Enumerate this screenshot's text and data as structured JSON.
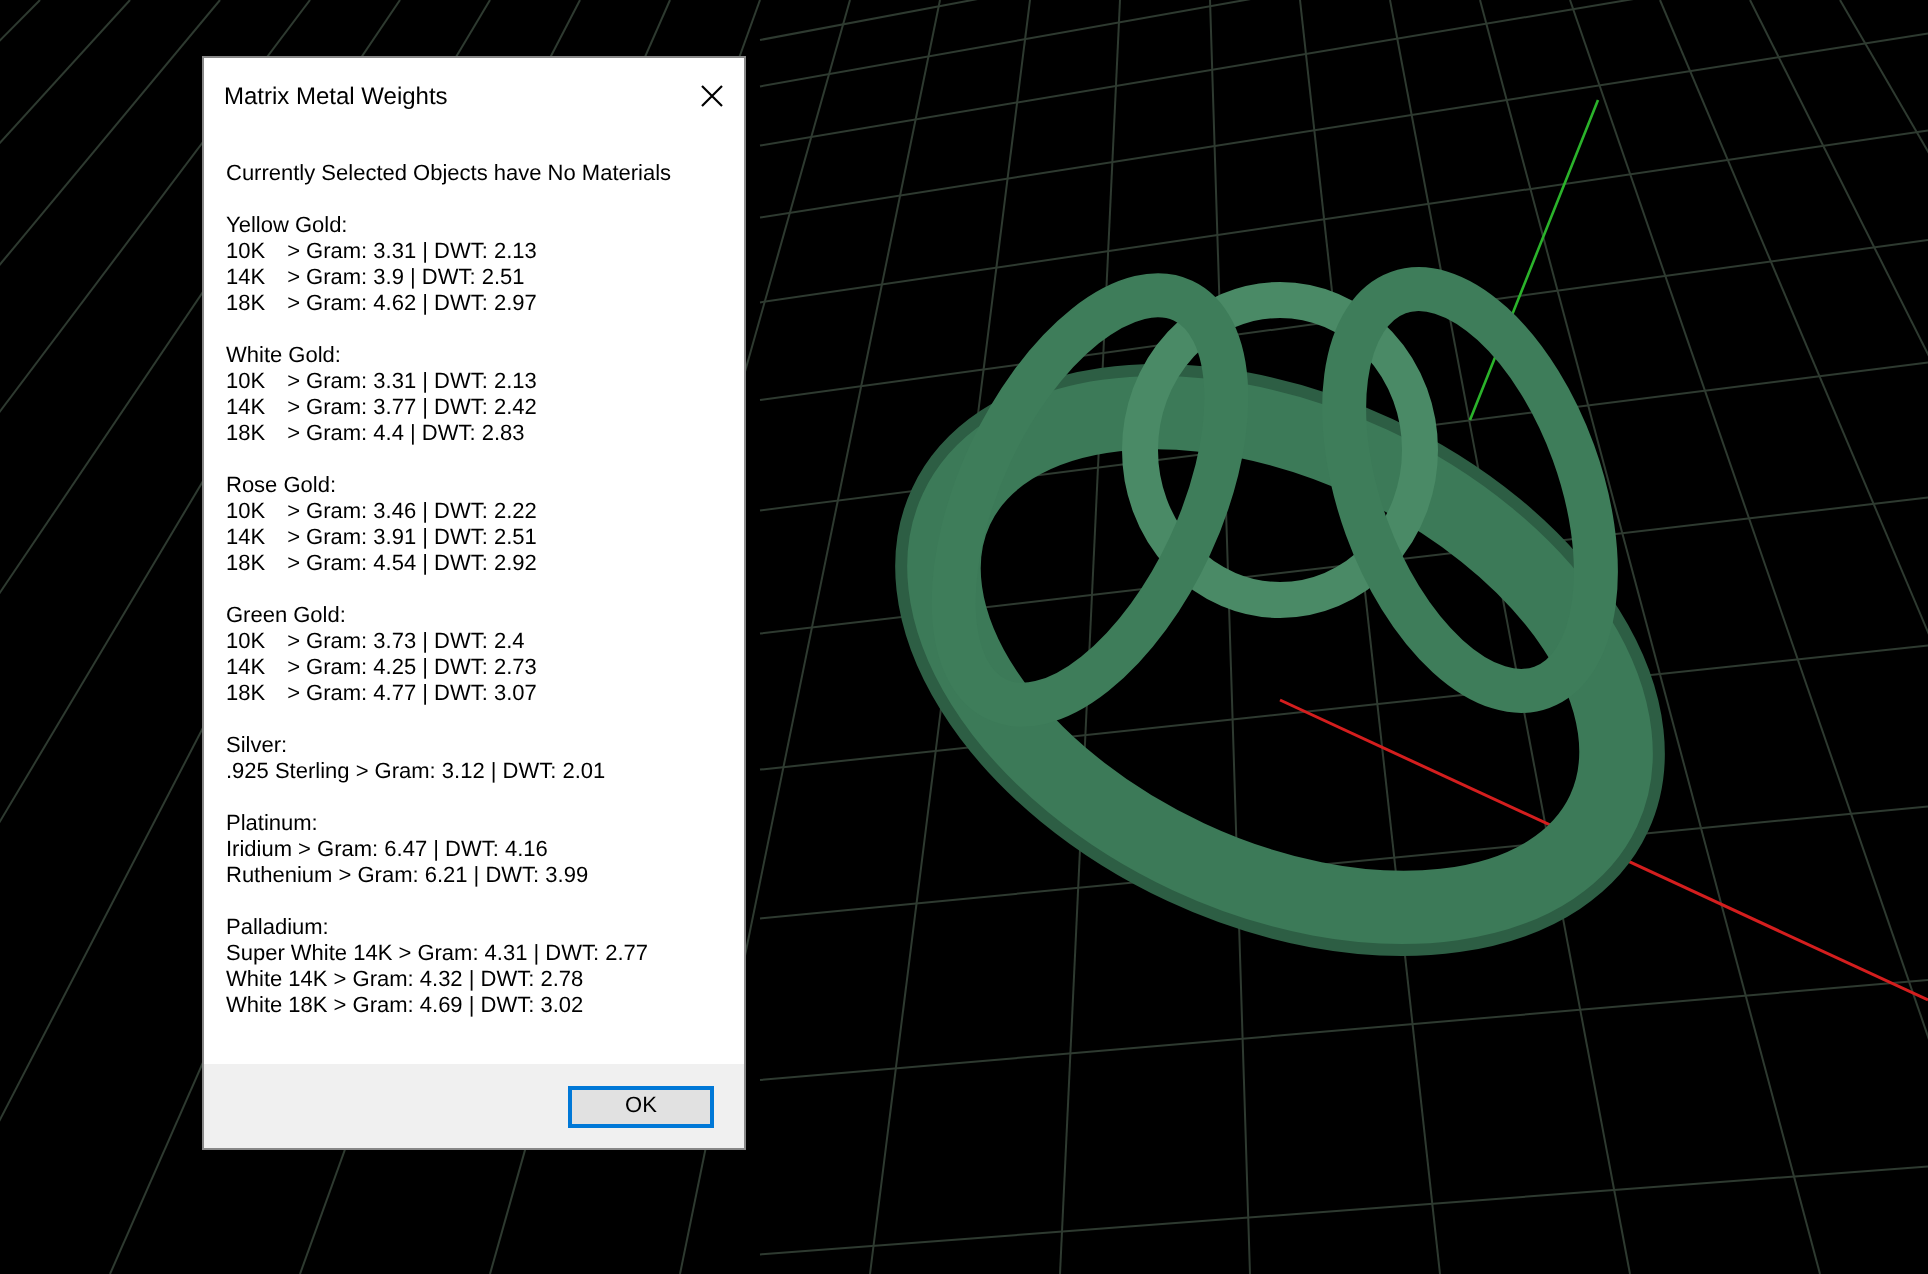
{
  "dialog": {
    "title": "Matrix Metal Weights",
    "message": "Currently Selected Objects have No Materials",
    "groups": [
      {
        "heading": "Yellow Gold:",
        "lines": [
          "10K\t> Gram: 3.31 | DWT: 2.13",
          "14K\t> Gram: 3.9 | DWT: 2.51",
          "18K\t> Gram: 4.62 | DWT: 2.97"
        ]
      },
      {
        "heading": "White Gold:",
        "lines": [
          "10K\t> Gram: 3.31 | DWT: 2.13",
          "14K\t> Gram: 3.77 | DWT: 2.42",
          "18K\t> Gram: 4.4 | DWT: 2.83"
        ]
      },
      {
        "heading": "Rose Gold:",
        "lines": [
          "10K\t> Gram: 3.46 | DWT: 2.22",
          "14K\t> Gram: 3.91 | DWT: 2.51",
          "18K\t> Gram: 4.54 | DWT: 2.92"
        ]
      },
      {
        "heading": "Green Gold:",
        "lines": [
          "10K\t> Gram: 3.73 | DWT: 2.4",
          "14K\t> Gram: 4.25 | DWT: 2.73",
          "18K\t> Gram: 4.77 | DWT: 3.07"
        ]
      },
      {
        "heading": "Silver:",
        "lines": [
          ".925 Sterling > Gram: 3.12 | DWT: 2.01"
        ]
      },
      {
        "heading": "Platinum:",
        "lines": [
          "Iridium > Gram: 6.47 | DWT: 4.16",
          "Ruthenium > Gram: 6.21 | DWT: 3.99"
        ]
      },
      {
        "heading": "Palladium:",
        "lines": [
          "Super White 14K > Gram: 4.31 | DWT: 2.77",
          "White 14K > Gram: 4.32 | DWT: 2.78",
          "White 18K > Gram: 4.69 | DWT: 3.02"
        ]
      }
    ],
    "button": "OK"
  }
}
